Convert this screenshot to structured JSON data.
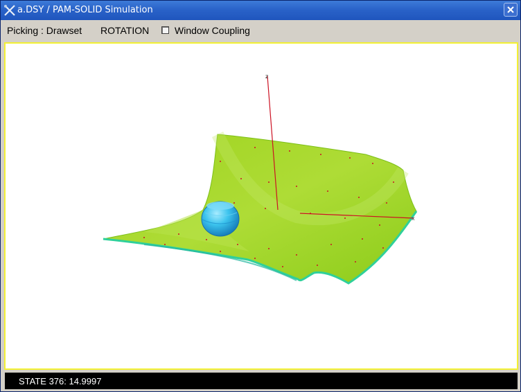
{
  "window": {
    "title": "a.DSY / PAM-SOLID Simulation",
    "app_icon": "tools-icon",
    "close_icon": "close-icon"
  },
  "toolbar": {
    "picking_label": "Picking : Drawset",
    "rotation_label": "ROTATION",
    "window_coupling_label": "Window Coupling",
    "window_coupling_checked": false
  },
  "viewport": {
    "background": "#ffffff",
    "border_color": "#f3f033",
    "sheet_color": "#a6d82a",
    "sheet_edge_color": "#2fd09a",
    "sphere_color": "#2ab8e6",
    "axis_color": "#cc1122"
  },
  "status": {
    "text": "STATE 376: 14.9997"
  }
}
